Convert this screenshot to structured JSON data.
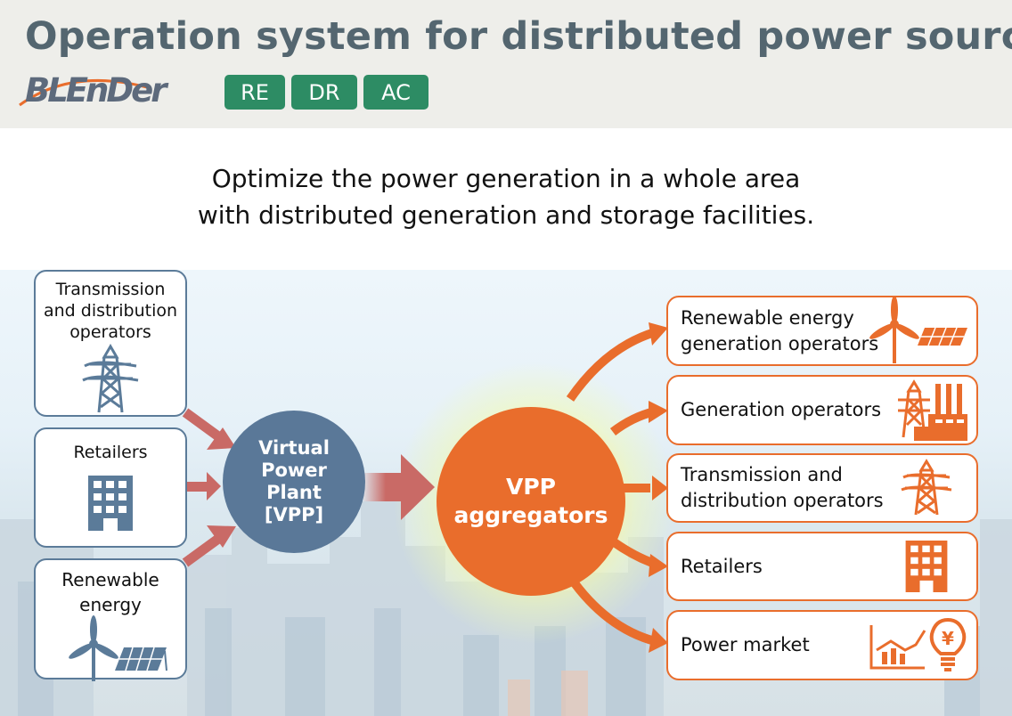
{
  "header": {
    "title": "Operation system for distributed power sources",
    "logo": "BLEnDer",
    "badges": [
      "RE",
      "DR",
      "AC"
    ],
    "badge_color": "#2d8c64"
  },
  "subtitle": {
    "line1": "Optimize the power generation in a whole area",
    "line2": "with distributed generation and storage facilities."
  },
  "sources": [
    {
      "label_lines": [
        "Transmission",
        "and distribution",
        "operators"
      ],
      "icon": "transmission-tower-icon"
    },
    {
      "label_lines": [
        "Retailers"
      ],
      "icon": "building-icon"
    },
    {
      "label_lines": [
        "Renewable",
        "energy"
      ],
      "icon": "wind-solar-icon"
    }
  ],
  "vpp": {
    "lines": [
      "Virtual",
      "Power",
      "Plant",
      "[VPP]"
    ],
    "color": "#5a7898"
  },
  "aggregator": {
    "lines": [
      "VPP",
      "aggregators"
    ],
    "color": "#e96d2c"
  },
  "targets": [
    {
      "label_lines": [
        "Renewable energy",
        "generation operators"
      ],
      "icon": "wind-solar-icon"
    },
    {
      "label_lines": [
        "Generation operators"
      ],
      "icon": "power-plant-icon"
    },
    {
      "label_lines": [
        "Transmission and",
        "distribution operators"
      ],
      "icon": "transmission-tower-icon"
    },
    {
      "label_lines": [
        "Retailers"
      ],
      "icon": "building-icon"
    },
    {
      "label_lines": [
        "Power market"
      ],
      "icon": "market-chart-yen-bulb-icon"
    }
  ],
  "colors": {
    "inbound_arrow": "#c96a66",
    "outbound_arrow": "#e96d2c",
    "source_border": "#5b7b99"
  }
}
